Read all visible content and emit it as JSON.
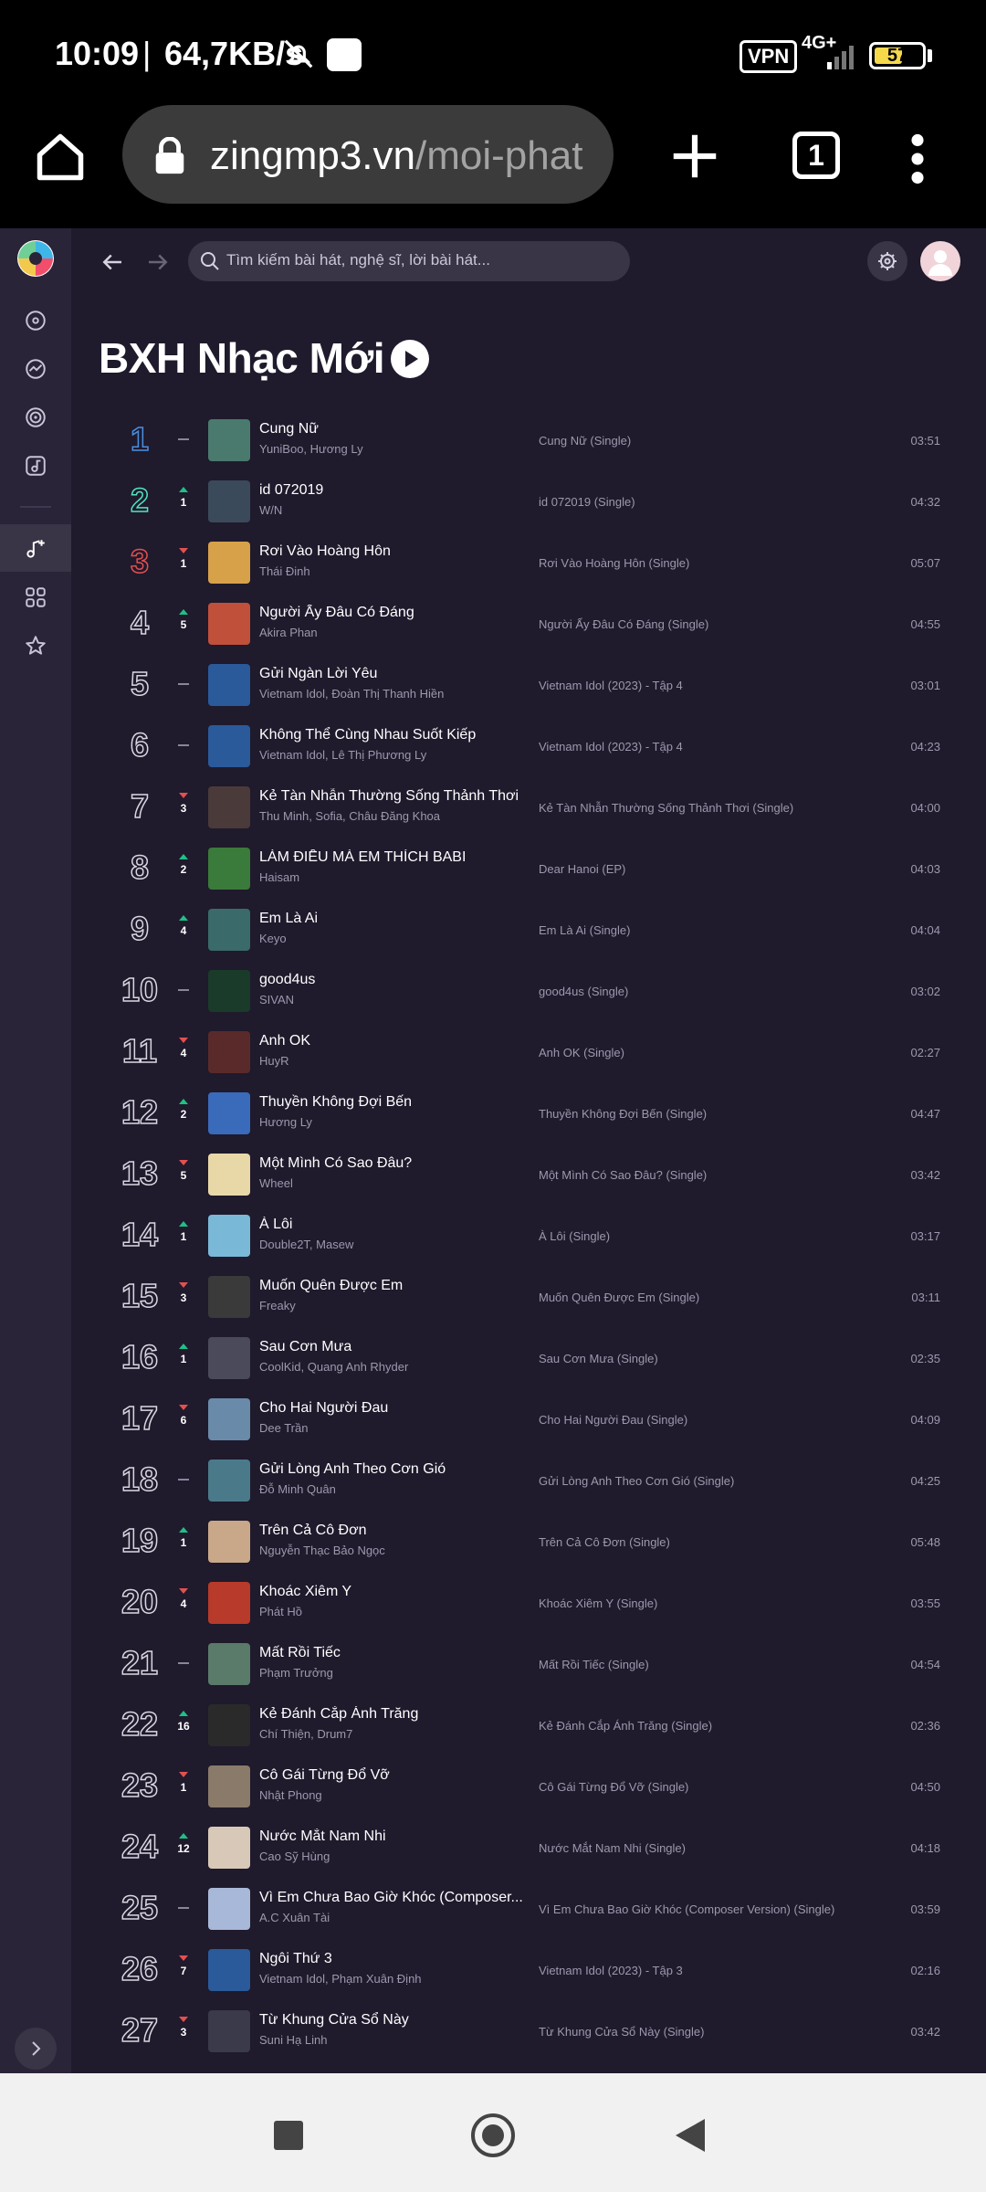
{
  "status": {
    "time": "10:09",
    "separator": "|",
    "speed": "64,7KB/s",
    "vpn": "VPN",
    "network": "4G+",
    "battery": "57"
  },
  "browser": {
    "url_host": "zingmp3.vn",
    "url_path": "/moi-phat",
    "tab_count": "1"
  },
  "app": {
    "search_placeholder": "Tìm kiếm bài hát, nghệ sĩ, lời bài hát...",
    "page_title": "BXH Nhạc Mới"
  },
  "songs": [
    {
      "rank": "1",
      "move": "none",
      "change": "",
      "title": "Cung Nữ",
      "artist": "YuniBoo, Hương Ly",
      "album": "Cung Nữ (Single)",
      "duration": "03:51",
      "thumb": "#4a7a6e"
    },
    {
      "rank": "2",
      "move": "up",
      "change": "1",
      "title": "id 072019",
      "artist": "W/N",
      "album": "id 072019 (Single)",
      "duration": "04:32",
      "thumb": "#3a4a5a"
    },
    {
      "rank": "3",
      "move": "down",
      "change": "1",
      "title": "Rơi Vào Hoàng Hôn",
      "artist": "Thái Đinh",
      "album": "Rơi Vào Hoàng Hôn (Single)",
      "duration": "05:07",
      "thumb": "#d7a14a"
    },
    {
      "rank": "4",
      "move": "up",
      "change": "5",
      "title": "Người Ấy Đâu Có Đáng",
      "artist": "Akira Phan",
      "album": "Người Ấy Đâu Có Đáng (Single)",
      "duration": "04:55",
      "thumb": "#c0503a"
    },
    {
      "rank": "5",
      "move": "none",
      "change": "",
      "title": "Gửi Ngàn Lời Yêu",
      "artist": "Vietnam Idol, Đoàn Thị Thanh Hiền",
      "album": "Vietnam Idol (2023) - Tập 4",
      "duration": "03:01",
      "thumb": "#2a5a9a"
    },
    {
      "rank": "6",
      "move": "none",
      "change": "",
      "title": "Không Thể Cùng Nhau Suốt Kiếp",
      "artist": "Vietnam Idol, Lê Thị Phương Ly",
      "album": "Vietnam Idol (2023) - Tập 4",
      "duration": "04:23",
      "thumb": "#2a5a9a"
    },
    {
      "rank": "7",
      "move": "down",
      "change": "3",
      "title": "Kẻ Tàn Nhẫn Thường Sống Thảnh Thơi",
      "artist": "Thu Minh, Sofia, Châu Đăng Khoa",
      "album": "Kẻ Tàn Nhẫn Thường Sống Thảnh Thơi (Single)",
      "duration": "04:00",
      "thumb": "#4a3a3a"
    },
    {
      "rank": "8",
      "move": "up",
      "change": "2",
      "title": "LÀM ĐIỀU MÀ EM THÍCH BABI",
      "artist": "Haisam",
      "album": "Dear Hanoi (EP)",
      "duration": "04:03",
      "thumb": "#3a7a3a"
    },
    {
      "rank": "9",
      "move": "up",
      "change": "4",
      "title": "Em Là Ai",
      "artist": "Keyo",
      "album": "Em Là Ai (Single)",
      "duration": "04:04",
      "thumb": "#3a6a6a"
    },
    {
      "rank": "10",
      "move": "none",
      "change": "",
      "title": "good4us",
      "artist": "SIVAN",
      "album": "good4us (Single)",
      "duration": "03:02",
      "thumb": "#1a3a2a"
    },
    {
      "rank": "11",
      "move": "down",
      "change": "4",
      "title": "Anh OK",
      "artist": "HuyR",
      "album": "Anh OK (Single)",
      "duration": "02:27",
      "thumb": "#5a2a2a"
    },
    {
      "rank": "12",
      "move": "up",
      "change": "2",
      "title": "Thuyền Không Đợi Bến",
      "artist": "Hương Ly",
      "album": "Thuyền Không Đợi Bến (Single)",
      "duration": "04:47",
      "thumb": "#3a6aba"
    },
    {
      "rank": "13",
      "move": "down",
      "change": "5",
      "title": "Một Mình Có Sao Đâu?",
      "artist": "Wheel",
      "album": "Một Mình Có Sao Đâu? (Single)",
      "duration": "03:42",
      "thumb": "#e8d8a8"
    },
    {
      "rank": "14",
      "move": "up",
      "change": "1",
      "title": "À Lôi",
      "artist": "Double2T, Masew",
      "album": "À Lôi (Single)",
      "duration": "03:17",
      "thumb": "#7ab8d8"
    },
    {
      "rank": "15",
      "move": "down",
      "change": "3",
      "title": "Muốn Quên Được Em",
      "artist": "Freaky",
      "album": "Muốn Quên Được Em (Single)",
      "duration": "03:11",
      "thumb": "#3a3a3a"
    },
    {
      "rank": "16",
      "move": "up",
      "change": "1",
      "title": "Sau Cơn Mưa",
      "artist": "CoolKid, Quang Anh Rhyder",
      "album": "Sau Cơn Mưa (Single)",
      "duration": "02:35",
      "thumb": "#4a4a5a"
    },
    {
      "rank": "17",
      "move": "down",
      "change": "6",
      "title": "Cho Hai Người Đau",
      "artist": "Dee Trần",
      "album": "Cho Hai Người Đau (Single)",
      "duration": "04:09",
      "thumb": "#6a8aaa"
    },
    {
      "rank": "18",
      "move": "none",
      "change": "",
      "title": "Gửi Lòng Anh Theo Cơn Gió",
      "artist": "Đỗ Minh Quân",
      "album": "Gửi Lòng Anh Theo Cơn Gió (Single)",
      "duration": "04:25",
      "thumb": "#4a7a8a"
    },
    {
      "rank": "19",
      "move": "up",
      "change": "1",
      "title": "Trên Cả Cô Đơn",
      "artist": "Nguyễn Thạc Bảo Ngọc",
      "album": "Trên Cả Cô Đơn (Single)",
      "duration": "05:48",
      "thumb": "#c8a888"
    },
    {
      "rank": "20",
      "move": "down",
      "change": "4",
      "title": "Khoác Xiêm Y",
      "artist": "Phát Hồ",
      "album": "Khoác Xiêm Y (Single)",
      "duration": "03:55",
      "thumb": "#b83a2a"
    },
    {
      "rank": "21",
      "move": "none",
      "change": "",
      "title": "Mất Rồi Tiếc",
      "artist": "Phạm Trưởng",
      "album": "Mất Rồi Tiếc (Single)",
      "duration": "04:54",
      "thumb": "#5a7a6a"
    },
    {
      "rank": "22",
      "move": "up",
      "change": "16",
      "title": "Kẻ Đánh Cắp Ánh Trăng",
      "artist": "Chí Thiện, Drum7",
      "album": "Kẻ Đánh Cắp Ánh Trăng (Single)",
      "duration": "02:36",
      "thumb": "#2a2a2a"
    },
    {
      "rank": "23",
      "move": "down",
      "change": "1",
      "title": "Cô Gái Từng Đổ Vỡ",
      "artist": "Nhật Phong",
      "album": "Cô Gái Từng Đổ Vỡ (Single)",
      "duration": "04:50",
      "thumb": "#8a7a6a"
    },
    {
      "rank": "24",
      "move": "up",
      "change": "12",
      "title": "Nước Mắt Nam Nhi",
      "artist": "Cao Sỹ Hùng",
      "album": "Nước Mắt Nam Nhi (Single)",
      "duration": "04:18",
      "thumb": "#d8c8b8"
    },
    {
      "rank": "25",
      "move": "none",
      "change": "",
      "title": "Vì Em Chưa Bao Giờ Khóc (Composer...",
      "artist": "A.C Xuân Tài",
      "album": "Vì Em Chưa Bao Giờ Khóc (Composer Version) (Single)",
      "duration": "03:59",
      "thumb": "#a8b8d8"
    },
    {
      "rank": "26",
      "move": "down",
      "change": "7",
      "title": "Ngôi Thứ 3",
      "artist": "Vietnam Idol, Phạm Xuân Định",
      "album": "Vietnam Idol (2023) - Tập 3",
      "duration": "02:16",
      "thumb": "#2a5a9a"
    },
    {
      "rank": "27",
      "move": "down",
      "change": "3",
      "title": "Từ Khung Cửa Sổ Này",
      "artist": "Suni Hạ Linh",
      "album": "Từ Khung Cửa Sổ Này (Single)",
      "duration": "03:42",
      "thumb": "#3a3a4a"
    }
  ]
}
